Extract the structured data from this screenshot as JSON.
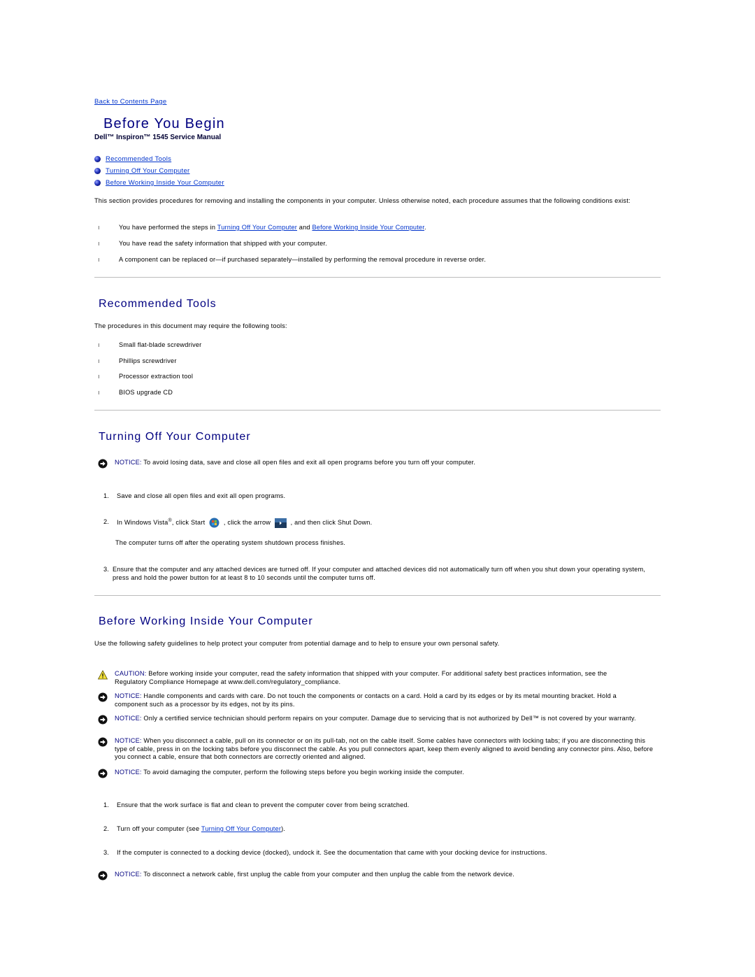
{
  "back_link": "Back to Contents Page",
  "title": "Before You Begin",
  "subtitle": "Dell™ Inspiron™ 1545 Service Manual",
  "toc": [
    {
      "label": "Recommended Tools"
    },
    {
      "label": "Turning Off Your Computer"
    },
    {
      "label": "Before Working Inside Your Computer"
    }
  ],
  "intro": {
    "text": "This section provides procedures for removing and installing the components in your computer. Unless otherwise noted, each procedure assumes that the following conditions exist:",
    "conditions": {
      "c1_prefix": "You have performed the steps in ",
      "c1_link1": "Turning Off Your Computer",
      "c1_mid": " and ",
      "c1_link2": "Before Working Inside Your Computer",
      "c1_suffix": ".",
      "c2": "You have read the safety information that shipped with your computer.",
      "c3": "A component can be replaced or—if purchased separately—installed by performing the removal procedure in reverse order."
    }
  },
  "recommended_tools": {
    "heading": "Recommended Tools",
    "intro": "The procedures in this document may require the following tools:",
    "items": [
      "Small flat-blade screwdriver",
      "Phillips screwdriver",
      "Processor extraction tool",
      "BIOS upgrade CD"
    ]
  },
  "turning_off": {
    "heading": "Turning Off Your Computer",
    "notice_label": "NOTICE:",
    "notice_text": " To avoid losing data, save and close all open files and exit all open programs before you turn off your computer.",
    "steps": {
      "s1_num": "1.",
      "s1": "Save and close all open files and exit all open programs.",
      "s2_num": "2.",
      "s2_a": "In Windows Vista",
      "s2_reg": "®",
      "s2_b": ", click Start ",
      "s2_c": " , click the arrow ",
      "s2_d": " , and then click Shut Down.",
      "s2_note": "The computer turns off after the operating system shutdown process finishes.",
      "s3_num": "3.",
      "s3": "Ensure that the computer and any attached devices are turned off. If your computer and attached devices did not automatically turn off when you shut down your operating system, press and hold the power button for at least 8 to 10 seconds until the computer turns off."
    }
  },
  "before_working": {
    "heading": "Before Working Inside Your Computer",
    "intro": "Use the following safety guidelines to help protect your computer from potential damage and to help to ensure your own personal safety.",
    "caution_label": "CAUTION:",
    "caution_text": " Before working inside your computer, read the safety information that shipped with your computer. For additional safety best practices information, see the Regulatory Compliance Homepage at www.dell.com/regulatory_compliance.",
    "notices": [
      {
        "label": "NOTICE:",
        "text": " Handle components and cards with care. Do not touch the components or contacts on a card. Hold a card by its edges or by its metal mounting bracket. Hold a component such as a processor by its edges, not by its pins."
      },
      {
        "label": "NOTICE:",
        "text": " Only a certified service technician should perform repairs on your computer. Damage due to servicing that is not authorized by Dell™ is not covered by your warranty."
      },
      {
        "label": "NOTICE:",
        "text": " When you disconnect a cable, pull on its connector or on its pull-tab, not on the cable itself. Some cables have connectors with locking tabs; if you are disconnecting this type of cable, press in on the locking tabs before you disconnect the cable. As you pull connectors apart, keep them evenly aligned to avoid bending any connector pins. Also, before you connect a cable, ensure that both connectors are correctly oriented and aligned."
      },
      {
        "label": "NOTICE:",
        "text": " To avoid damaging the computer, perform the following steps before you begin working inside the computer."
      }
    ],
    "steps": {
      "s1_num": "1.",
      "s1": "Ensure that the work surface is flat and clean to prevent the computer cover from being scratched.",
      "s2_num": "2.",
      "s2_prefix": "Turn off your computer (see ",
      "s2_link": "Turning Off Your Computer",
      "s2_suffix": ").",
      "s3_num": "3.",
      "s3": "If the computer is connected to a docking device (docked), undock it. See the documentation that came with your docking device for instructions."
    },
    "final_notice_label": "NOTICE:",
    "final_notice_text": " To disconnect a network cable, first unplug the cable from your computer and then unplug the cable from the network device."
  },
  "colors": {
    "heading": "#000080",
    "link": "#0033cc",
    "rule": "#bbbbbb"
  }
}
